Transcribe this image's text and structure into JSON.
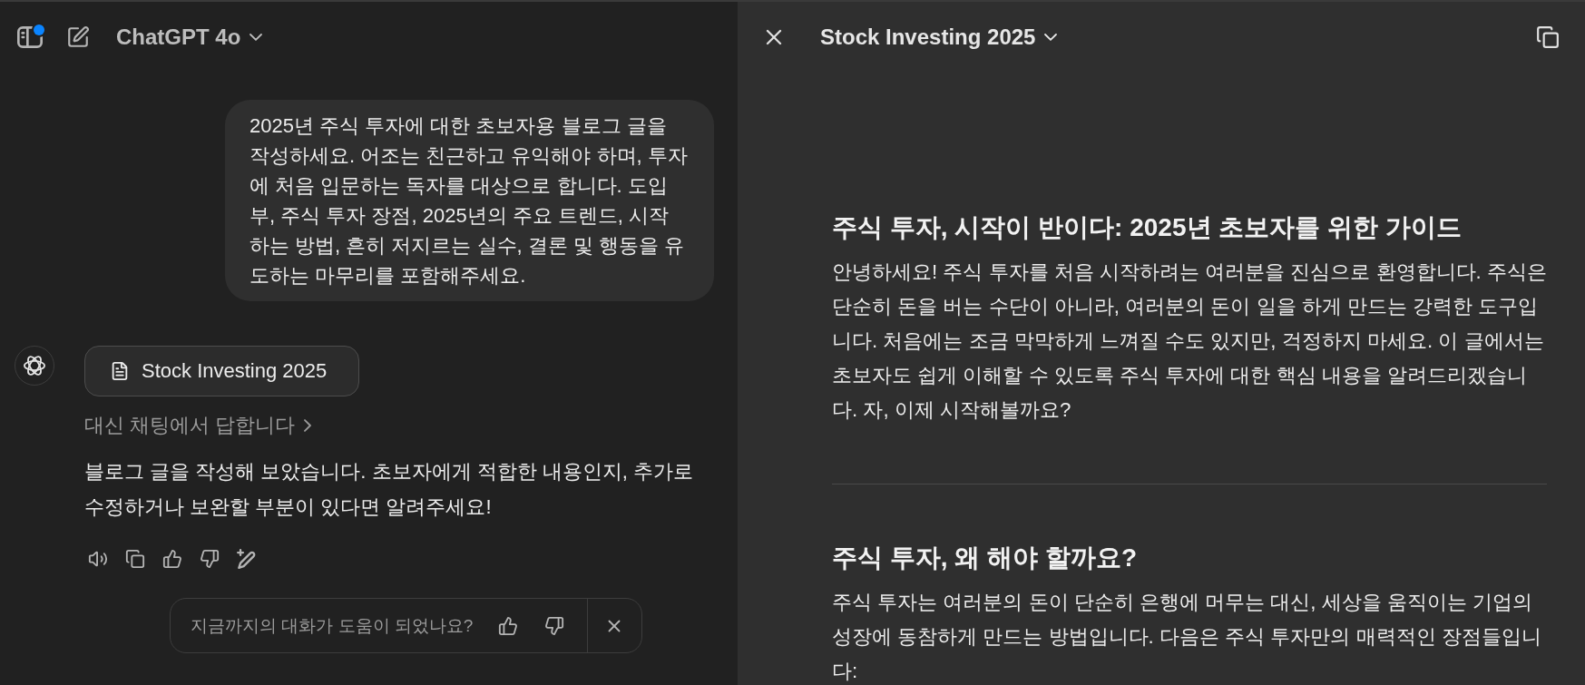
{
  "header": {
    "model": "ChatGPT 4o",
    "sidebar_badge": true
  },
  "user_message": "2025년 주식 투자에 대한 초보자용 블로그 글을 작성하세요. 어조는 친근하고 유익해야 하며, 투자에 처음 입문하는 독자를 대상으로 합니다. 도입부, 주식 투자 장점, 2025년의 주요 트렌드, 시작하는 방법, 흔히 저지르는 실수, 결론 및 행동을 유도하는 마무리를 포함해주세요.",
  "assistant": {
    "canvas_button": "Stock Investing 2025",
    "reply_link": "대신 채팅에서 답합니다",
    "text": "블로그 글을 작성해 보았습니다. 초보자에게 적합한 내용인지, 추가로 수정하거나 보완할 부분이 있다면 알려주세요!"
  },
  "feedback": {
    "question": "지금까지의 대화가 도움이 되었나요?"
  },
  "canvas": {
    "title": "Stock Investing 2025",
    "sections": [
      {
        "heading": "주식 투자, 시작이 반이다: 2025년 초보자를 위한 가이드",
        "paragraph": "안녕하세요! 주식 투자를 처음 시작하려는 여러분을 진심으로 환영합니다. 주식은 단순히 돈을 버는 수단이 아니라, 여러분의 돈이 일을 하게 만드는 강력한 도구입니다. 처음에는 조금 막막하게 느껴질 수도 있지만, 걱정하지 마세요. 이 글에서는 초보자도 쉽게 이해할 수 있도록 주식 투자에 대한 핵심 내용을 알려드리겠습니다. 자, 이제 시작해볼까요?"
      },
      {
        "heading": "주식 투자, 왜 해야 할까요?",
        "paragraph": "주식 투자는 여러분의 돈이 단순히 은행에 머무는 대신, 세상을 움직이는 기업의 성장에 동참하게 만드는 방법입니다. 다음은 주식 투자만의 매력적인 장점들입니다:"
      }
    ]
  }
}
